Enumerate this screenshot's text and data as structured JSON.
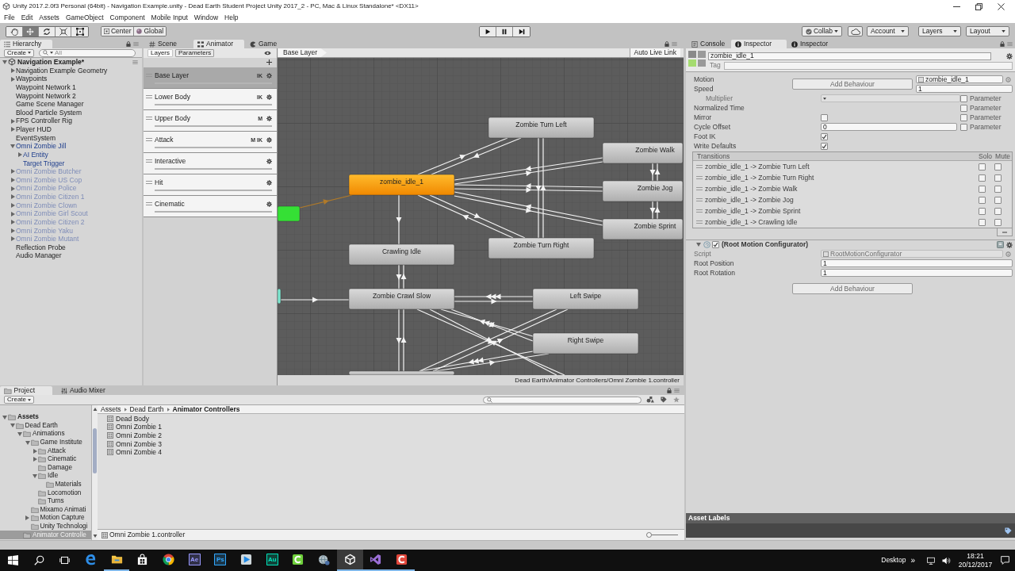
{
  "window": {
    "title": "Unity 2017.2.0f3 Personal (64bit) - Navigation Example.unity - Dead Earth Student Project Unity 2017_2 - PC, Mac & Linux Standalone* <DX11>"
  },
  "menu": [
    "File",
    "Edit",
    "Assets",
    "GameObject",
    "Component",
    "Mobile Input",
    "Window",
    "Help"
  ],
  "toolbar": {
    "tools": [
      {
        "kind": "hand",
        "selected": false
      },
      {
        "kind": "move",
        "selected": true
      },
      {
        "kind": "rotate",
        "selected": false
      },
      {
        "kind": "scale",
        "selected": false
      },
      {
        "kind": "rect",
        "selected": false
      }
    ],
    "pivot": [
      {
        "kind": "pivot",
        "label": "Center"
      },
      {
        "kind": "space",
        "label": "Global"
      }
    ],
    "playback": [
      {
        "kind": "play"
      },
      {
        "kind": "pause"
      },
      {
        "kind": "step"
      }
    ],
    "collab": "Collab",
    "account": "Account",
    "layers": "Layers",
    "layout": "Layout"
  },
  "hierarchy": {
    "tab": "Hierarchy",
    "create": "Create",
    "search_placeholder": "All",
    "scene": {
      "name": "Navigation Example*",
      "expanded": true,
      "children": [
        {
          "name": "Navigation Example Geometry",
          "kind": "object",
          "active": true,
          "expanded": false
        },
        {
          "name": "Waypoints",
          "kind": "object",
          "active": true,
          "expanded": false
        },
        {
          "name": "Waypoint Network 1",
          "kind": "object",
          "active": true
        },
        {
          "name": "Waypoint Network 2",
          "kind": "object",
          "active": true
        },
        {
          "name": "Game Scene Manager",
          "kind": "object",
          "active": true
        },
        {
          "name": "Blood Particle System",
          "kind": "object",
          "active": true
        },
        {
          "name": "FPS Controller Rig",
          "kind": "object",
          "active": true,
          "expanded": false
        },
        {
          "name": "Player HUD",
          "kind": "object",
          "active": true,
          "expanded": false
        },
        {
          "name": "EventSystem",
          "kind": "object",
          "active": true
        },
        {
          "name": "Omni Zombie Jill",
          "kind": "prefab",
          "active": true,
          "expanded": true,
          "children": [
            {
              "name": "AI Entity",
              "kind": "prefab",
              "active": true,
              "expanded": false
            },
            {
              "name": "Target Trigger",
              "kind": "prefab",
              "active": true
            }
          ]
        },
        {
          "name": "Omni Zombie Butcher",
          "kind": "prefab",
          "active": false,
          "expanded": false
        },
        {
          "name": "Omni Zombie US Cop",
          "kind": "prefab",
          "active": false,
          "expanded": false
        },
        {
          "name": "Omni Zombie Police",
          "kind": "prefab",
          "active": false,
          "expanded": false
        },
        {
          "name": "Omni Zombie Citizen 1",
          "kind": "prefab",
          "active": false,
          "expanded": false
        },
        {
          "name": "Omni Zombie Clown",
          "kind": "prefab",
          "active": false,
          "expanded": false
        },
        {
          "name": "Omni Zombie Girl Scout",
          "kind": "prefab",
          "active": false,
          "expanded": false
        },
        {
          "name": "Omni Zombie Citizen 2",
          "kind": "prefab",
          "active": false,
          "expanded": false
        },
        {
          "name": "Omni Zombie Yaku",
          "kind": "prefab",
          "active": false,
          "expanded": false
        },
        {
          "name": "Omni Zombie Mutant",
          "kind": "prefab",
          "active": false,
          "expanded": false
        },
        {
          "name": "Reflection Probe",
          "kind": "object",
          "active": true
        },
        {
          "name": "Audio Manager",
          "kind": "object",
          "active": true
        }
      ]
    }
  },
  "animator": {
    "tabs": [
      {
        "label": "Scene",
        "kind": "scene",
        "selected": false
      },
      {
        "label": "Animator",
        "kind": "animator",
        "selected": true
      },
      {
        "label": "Game",
        "kind": "game",
        "selected": false
      }
    ],
    "side_tabs": [
      {
        "label": "Layers",
        "selected": true
      },
      {
        "label": "Parameters",
        "selected": false
      }
    ],
    "layers": [
      {
        "name": "Base Layer",
        "selected": true,
        "badges": [
          "IK"
        ],
        "level": 1
      },
      {
        "name": "Lower Body",
        "selected": false,
        "badges": [
          "IK"
        ],
        "level": 1
      },
      {
        "name": "Upper Body",
        "selected": false,
        "badges": [
          "M"
        ],
        "level": 1
      },
      {
        "name": "Attack",
        "selected": false,
        "badges": [
          "M",
          "IK"
        ],
        "level": 1
      },
      {
        "name": "Interactive",
        "selected": false,
        "level": 1
      },
      {
        "name": "Hit",
        "selected": false,
        "level": 1
      },
      {
        "name": "Cinematic",
        "selected": false,
        "level": 1
      }
    ],
    "breadcrumb": "Base Layer",
    "live_link": "Auto Live Link",
    "graph": {
      "nodes": [
        {
          "kind": "state",
          "label": "Zombie Turn Left"
        },
        {
          "kind": "state",
          "label": "Zombie Walk"
        },
        {
          "kind": "default",
          "label": "zombie_idle_1"
        },
        {
          "kind": "state",
          "label": "Zombie Jog"
        },
        {
          "kind": "state",
          "label": "Zombie Sprint"
        },
        {
          "kind": "state",
          "label": "Crawling Idle"
        },
        {
          "kind": "state",
          "label": "Zombie Turn Right"
        },
        {
          "kind": "state",
          "label": "Zombie Crawl Slow"
        },
        {
          "kind": "state",
          "label": "Left Swipe"
        },
        {
          "kind": "state",
          "label": "Right Swipe"
        },
        {
          "kind": "entry"
        },
        {
          "kind": "any_state"
        },
        {
          "kind": "state"
        }
      ]
    },
    "path": "Dead Earth/Animator Controllers/Omni Zombie 1.controller"
  },
  "inspector": {
    "tabs": [
      {
        "label": "Console",
        "kind": "console",
        "selected": false
      },
      {
        "label": "Inspector",
        "kind": "inspector",
        "selected": true
      },
      {
        "label": "Inspector",
        "kind": "inspector",
        "selected": false
      }
    ],
    "name": "zombie_idle_1",
    "tag_label": "Tag",
    "overlay_button": "Add Behaviour",
    "properties": [
      {
        "label": "Motion",
        "kind": "object",
        "value": "zombie_idle_1",
        "disabled": false
      },
      {
        "label": "Speed",
        "kind": "field",
        "value": "1",
        "disabled": false,
        "children": [
          {
            "label": "Multiplier",
            "kind": "dropdown",
            "disabled": true,
            "parameter": {
              "label": "Parameter",
              "checked": false
            }
          }
        ]
      },
      {
        "label": "Normalized Time",
        "kind": "empty",
        "disabled": false,
        "parameter": {
          "label": "Parameter",
          "checked": false
        }
      },
      {
        "label": "Mirror",
        "kind": "checkbox",
        "checked": false,
        "disabled": false,
        "parameter": {
          "label": "Parameter",
          "checked": false
        }
      },
      {
        "label": "Cycle Offset",
        "kind": "field",
        "value": "0",
        "disabled": false,
        "parameter": {
          "label": "Parameter",
          "checked": false
        }
      },
      {
        "label": "Foot IK",
        "kind": "checkbox",
        "checked": true,
        "disabled": false
      },
      {
        "label": "Write Defaults",
        "kind": "checkbox",
        "checked": true,
        "disabled": false
      }
    ],
    "transitions": {
      "title": "Transitions",
      "solo": "Solo",
      "mute": "Mute",
      "rows": [
        {
          "label": "zombie_idle_1 -> Zombie Turn Left",
          "solo": false,
          "mute": false
        },
        {
          "label": "zombie_idle_1 -> Zombie Turn Right",
          "solo": false,
          "mute": false
        },
        {
          "label": "zombie_idle_1 -> Zombie Walk",
          "solo": false,
          "mute": false
        },
        {
          "label": "zombie_idle_1 -> Zombie Jog",
          "solo": false,
          "mute": false
        },
        {
          "label": "zombie_idle_1 -> Zombie Sprint",
          "solo": false,
          "mute": false
        },
        {
          "label": "zombie_idle_1 -> Crawling Idle",
          "solo": false,
          "mute": false
        }
      ]
    },
    "component": {
      "title": "(Root Motion Configurator)",
      "expanded": true,
      "enabled": true,
      "fields": [
        {
          "label": "Script",
          "kind": "script",
          "value": "RootMotionConfigurator",
          "disabled": true
        },
        {
          "label": "Root Position",
          "kind": "field",
          "value": "1",
          "disabled": false
        },
        {
          "label": "Root Rotation",
          "kind": "field",
          "value": "1",
          "disabled": false
        }
      ]
    },
    "add_button": "Add Behaviour",
    "asset_labels": "Asset Labels"
  },
  "project": {
    "tabs": [
      {
        "label": "Project",
        "kind": "project",
        "selected": true
      },
      {
        "label": "Audio Mixer",
        "kind": "mixer",
        "selected": false
      }
    ],
    "create": "Create",
    "tree": [
      {
        "name": "Assets",
        "expanded": true,
        "selected": false,
        "children": [
          {
            "name": "Dead Earth",
            "expanded": true,
            "selected": false,
            "children": [
              {
                "name": "Animations",
                "expanded": true,
                "selected": false,
                "children": [
                  {
                    "name": "Game Institute",
                    "expanded": true,
                    "selected": false,
                    "children": [
                      {
                        "name": "Attack",
                        "expanded": false,
                        "selected": false
                      },
                      {
                        "name": "Cinematic",
                        "expanded": false,
                        "selected": false
                      },
                      {
                        "name": "Damage",
                        "selected": false
                      },
                      {
                        "name": "Idle",
                        "expanded": true,
                        "selected": false,
                        "children": [
                          {
                            "name": "Materials",
                            "selected": false
                          }
                        ]
                      },
                      {
                        "name": "Locomotion",
                        "selected": false
                      },
                      {
                        "name": "Turns",
                        "selected": false
                      }
                    ]
                  },
                  {
                    "name": "Mixamo Animati",
                    "selected": false
                  },
                  {
                    "name": "Motion Capture",
                    "expanded": false,
                    "selected": false
                  },
                  {
                    "name": "Unity Technologi",
                    "selected": false
                  }
                ]
              },
              {
                "name": "Animator Controlle",
                "selected": true
              }
            ]
          }
        ]
      }
    ],
    "breadcrumb": [
      "Assets",
      "Dead Earth",
      "Animator Controllers"
    ],
    "files": [
      "Dead Body",
      "Omni Zombie 1",
      "Omni Zombie 2",
      "Omni Zombie 3",
      "Omni Zombie 4"
    ],
    "selected_path": "Omni Zombie 1.controller",
    "zoom_slider": {
      "level": 0
    }
  },
  "taskbar": {
    "system": [
      {
        "kind": "start"
      },
      {
        "kind": "search"
      },
      {
        "kind": "task_view"
      }
    ],
    "apps": [
      {
        "kind": "edge",
        "running": false,
        "selected": false
      },
      {
        "kind": "explorer",
        "running": true,
        "selected": false
      },
      {
        "kind": "store",
        "running": false,
        "selected": false
      },
      {
        "kind": "chrome",
        "running": false,
        "selected": false
      },
      {
        "kind": "tile",
        "label": "Ae",
        "color": "#9999ff",
        "running": false,
        "selected": false
      },
      {
        "kind": "tile",
        "label": "Ps",
        "color": "#31a8ff",
        "running": false,
        "selected": false
      },
      {
        "kind": "media",
        "running": false,
        "selected": false
      },
      {
        "kind": "tile",
        "label": "Au",
        "color": "#00e4bb",
        "running": false,
        "selected": false
      },
      {
        "kind": "green_c",
        "running": false,
        "selected": false
      },
      {
        "kind": "globe",
        "running": false,
        "selected": false
      },
      {
        "kind": "unity",
        "running": true,
        "selected": true
      },
      {
        "kind": "vs",
        "running": true,
        "selected": false
      },
      {
        "kind": "red_c",
        "running": true,
        "selected": false
      }
    ],
    "desktop": "Desktop",
    "overflow": "»",
    "time": "18:21",
    "date": "20/12/2017"
  }
}
